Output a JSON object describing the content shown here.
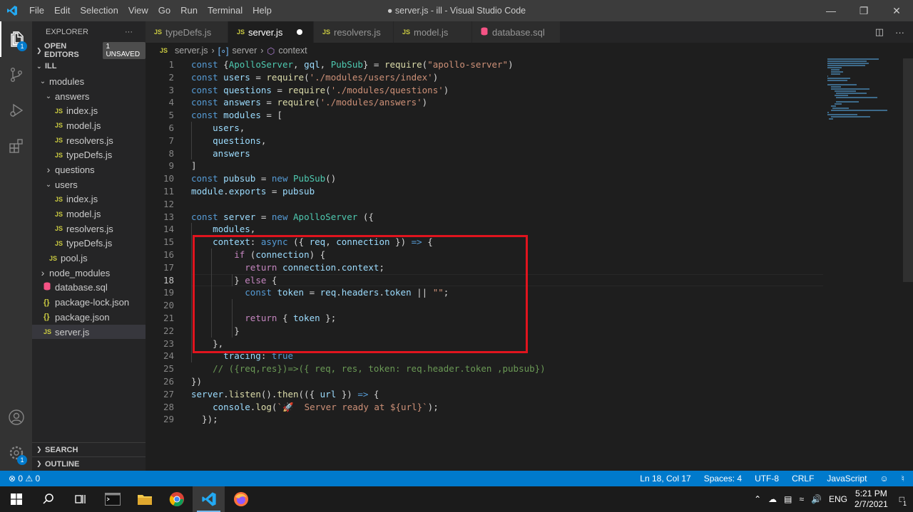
{
  "window": {
    "title": "● server.js - ill - Visual Studio Code",
    "menu": [
      "File",
      "Edit",
      "Selection",
      "View",
      "Go",
      "Run",
      "Terminal",
      "Help"
    ]
  },
  "activity_bar": {
    "explorer_badge": "1",
    "settings_badge": "1"
  },
  "sidebar": {
    "header": "EXPLORER",
    "more": "···",
    "open_editors": "OPEN EDITORS",
    "unsaved": "1 UNSAVED",
    "root": "ILL",
    "tree": [
      {
        "label": "modules",
        "type": "folder-open",
        "depth": 1
      },
      {
        "label": "answers",
        "type": "folder-open",
        "depth": 2
      },
      {
        "label": "index.js",
        "type": "js",
        "depth": 3
      },
      {
        "label": "model.js",
        "type": "js",
        "depth": 3
      },
      {
        "label": "resolvers.js",
        "type": "js",
        "depth": 3
      },
      {
        "label": "typeDefs.js",
        "type": "js",
        "depth": 3
      },
      {
        "label": "questions",
        "type": "folder-closed",
        "depth": 2
      },
      {
        "label": "users",
        "type": "folder-open",
        "depth": 2
      },
      {
        "label": "index.js",
        "type": "js",
        "depth": 3
      },
      {
        "label": "model.js",
        "type": "js",
        "depth": 3
      },
      {
        "label": "resolvers.js",
        "type": "js",
        "depth": 3
      },
      {
        "label": "typeDefs.js",
        "type": "js",
        "depth": 3
      },
      {
        "label": "pool.js",
        "type": "js",
        "depth": 2
      },
      {
        "label": "node_modules",
        "type": "folder-closed",
        "depth": 1
      },
      {
        "label": "database.sql",
        "type": "db",
        "depth": 1
      },
      {
        "label": "package-lock.json",
        "type": "json",
        "depth": 1
      },
      {
        "label": "package.json",
        "type": "json",
        "depth": 1
      },
      {
        "label": "server.js",
        "type": "js",
        "depth": 1,
        "selected": true
      }
    ],
    "search": "SEARCH",
    "outline": "OUTLINE"
  },
  "tabs": [
    {
      "label": "typeDefs.js",
      "type": "js"
    },
    {
      "label": "server.js",
      "type": "js",
      "active": true,
      "unsaved": true
    },
    {
      "label": "resolvers.js",
      "type": "js"
    },
    {
      "label": "model.js",
      "type": "js"
    },
    {
      "label": "database.sql",
      "type": "db"
    }
  ],
  "breadcrumb": [
    "server.js",
    "server",
    "context"
  ],
  "editor": {
    "current_line": 18,
    "lines": [
      "const {ApolloServer, gql, PubSub} = require(\"apollo-server\")",
      "const users = require('./modules/users/index')",
      "const questions = require('./modules/questions')",
      "const answers = require('./modules/answers')",
      "const modules = [",
      "    users,",
      "    questions,",
      "    answers",
      "]",
      "const pubsub = new PubSub()",
      "module.exports = pubsub",
      "",
      "const server = new ApolloServer ({",
      "    modules,",
      "    context: async ({ req, connection }) => {",
      "        if (connection) {",
      "          return connection.context;",
      "        } else {",
      "          const token = req.headers.token || \"\";",
      "",
      "          return { token };",
      "        }",
      "    },",
      "      tracing: true",
      "    // ({req,res})=>({ req, res, token: req.header.token ,pubsub})",
      "})",
      "server.listen().then(({ url }) => {",
      "    console.log(`🚀  Server ready at ${url}`);",
      "  });"
    ]
  },
  "status_bar": {
    "errors": "⊗ 0 ⚠ 0",
    "position": "Ln 18, Col 17",
    "spaces": "Spaces: 4",
    "encoding": "UTF-8",
    "eol": "CRLF",
    "language": "JavaScript"
  },
  "taskbar": {
    "lang": "ENG",
    "time": "5:21 PM",
    "date": "2/7/2021",
    "notif": "1"
  }
}
